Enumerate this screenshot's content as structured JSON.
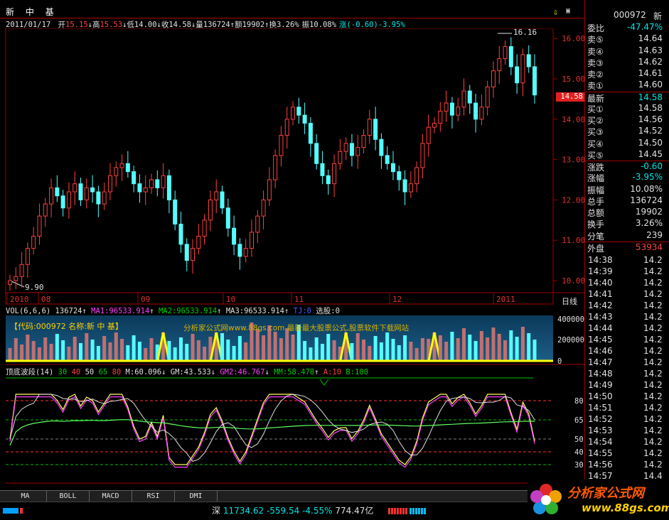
{
  "header": {
    "stock_name": "新 中 基",
    "date": "2011/01/17",
    "open_label": "开",
    "open": "15.15",
    "high_label": "高",
    "high": "15.53",
    "low_label": "低",
    "low": "14.00",
    "close_label": "收",
    "close": "14.58",
    "volume_label": "量",
    "volume": "136724",
    "amount_label": "额",
    "amount": "19902",
    "turnover_label": "换",
    "turnover": "3.26%",
    "amplitude_label": "振",
    "amplitude": "10.08%",
    "change_label": "涨",
    "change": "(-0.60)-3.95%"
  },
  "main_chart": {
    "high_marker": "16.16",
    "low_marker": "9.90",
    "price_tag": "14.58",
    "y_ticks": [
      "16.00",
      "15.00",
      "14.00",
      "13.00",
      "12.00",
      "11.00",
      "10.00"
    ],
    "x_ticks": [
      "2010",
      "08",
      "09",
      "10",
      "11",
      "12",
      "2011"
    ],
    "period": "日线"
  },
  "volume_panel": {
    "title": "VOL(6,6,6)",
    "vol": "136724",
    "ma1": "MA1:96533.914",
    "ma2": "MA2:96533.914",
    "ma3": "MA3:96533.914",
    "extra": "TJ:0",
    "select": "选股:0",
    "banner": "【代码:000972 名称:新 中 基】",
    "watermark": "分析家公式网www.88gs.com 最新最大股票公式,股票软件下载网站",
    "y_ticks": [
      "400000",
      "200000",
      "0"
    ]
  },
  "indicator_panel": {
    "name": "顶底波段(14)",
    "levels": [
      "30",
      "40",
      "50",
      "65",
      "80"
    ],
    "m": "M:60.096",
    "gm": "GM:43.533",
    "gm2": "GM2:46.767",
    "mm": "MM:58.478",
    "a": "A:10",
    "b": "B:100",
    "y_ticks": [
      "80",
      "65",
      "50",
      "40",
      "30"
    ]
  },
  "tabs": [
    "MA",
    "BOLL",
    "MACD",
    "RSI",
    "DMI"
  ],
  "sidebar": {
    "code": "000972",
    "name_short": "新",
    "rows": [
      {
        "label": "委比",
        "value": "-47.47%",
        "color": "#00e5e5"
      },
      {
        "label": "卖⑤",
        "value": "14.64",
        "color": "#e0e0e0"
      },
      {
        "label": "卖④",
        "value": "14.63",
        "color": "#e0e0e0"
      },
      {
        "label": "卖③",
        "value": "14.62",
        "color": "#e0e0e0"
      },
      {
        "label": "卖②",
        "value": "14.61",
        "color": "#e0e0e0"
      },
      {
        "label": "卖①",
        "value": "14.60",
        "color": "#e0e0e0"
      },
      {
        "label": "最新",
        "value": "14.58",
        "color": "#00e5e5"
      },
      {
        "label": "买①",
        "value": "14.58",
        "color": "#e0e0e0"
      },
      {
        "label": "买②",
        "value": "14.56",
        "color": "#e0e0e0"
      },
      {
        "label": "买③",
        "value": "14.52",
        "color": "#e0e0e0"
      },
      {
        "label": "买④",
        "value": "14.50",
        "color": "#e0e0e0"
      },
      {
        "label": "买⑤",
        "value": "14.45",
        "color": "#e0e0e0"
      },
      {
        "label": "涨跌",
        "value": "-0.60",
        "color": "#00e5e5"
      },
      {
        "label": "涨幅",
        "value": "-3.95%",
        "color": "#00e5e5"
      },
      {
        "label": "振幅",
        "value": "10.08%",
        "color": "#e0e0e0"
      },
      {
        "label": "总手",
        "value": "136724",
        "color": "#e0e0e0"
      },
      {
        "label": "总额",
        "value": "19902",
        "color": "#e0e0e0"
      },
      {
        "label": "换手",
        "value": "3.26%",
        "color": "#e0e0e0"
      },
      {
        "label": "分笔",
        "value": "239",
        "color": "#e0e0e0"
      },
      {
        "label": "外盘",
        "value": "53934",
        "color": "#ff4040"
      }
    ],
    "ticks": [
      {
        "time": "14:38",
        "price": "14.2"
      },
      {
        "time": "14:39",
        "price": "14.2"
      },
      {
        "time": "14:40",
        "price": "14.2"
      },
      {
        "time": "14:41",
        "price": "14.2"
      },
      {
        "time": "14:42",
        "price": "14.2"
      },
      {
        "time": "14:43",
        "price": "14.2"
      },
      {
        "time": "14:44",
        "price": "14.2"
      },
      {
        "time": "14:45",
        "price": "14.2"
      },
      {
        "time": "14:46",
        "price": "14.2"
      },
      {
        "time": "14:47",
        "price": "14.2"
      },
      {
        "time": "14:48",
        "price": "14.2"
      },
      {
        "time": "14:49",
        "price": "14.2"
      },
      {
        "time": "14:50",
        "price": "14.2"
      },
      {
        "time": "14:51",
        "price": "14.2"
      },
      {
        "time": "14:52",
        "price": "14.2"
      },
      {
        "time": "14:53",
        "price": "14.2"
      },
      {
        "time": "14:54",
        "price": "14.2"
      },
      {
        "time": "14:55",
        "price": "14.2"
      },
      {
        "time": "14:56",
        "price": "14.2"
      },
      {
        "time": "14:57",
        "price": "14.4"
      }
    ]
  },
  "status": {
    "index_name": "深",
    "index_value": "11734.62",
    "index_change": "-559.54",
    "index_pct": "-4.55%",
    "index_amount": "774.47亿",
    "logo_text": "分析家公式网",
    "logo_url": "www.88gs.com"
  }
}
